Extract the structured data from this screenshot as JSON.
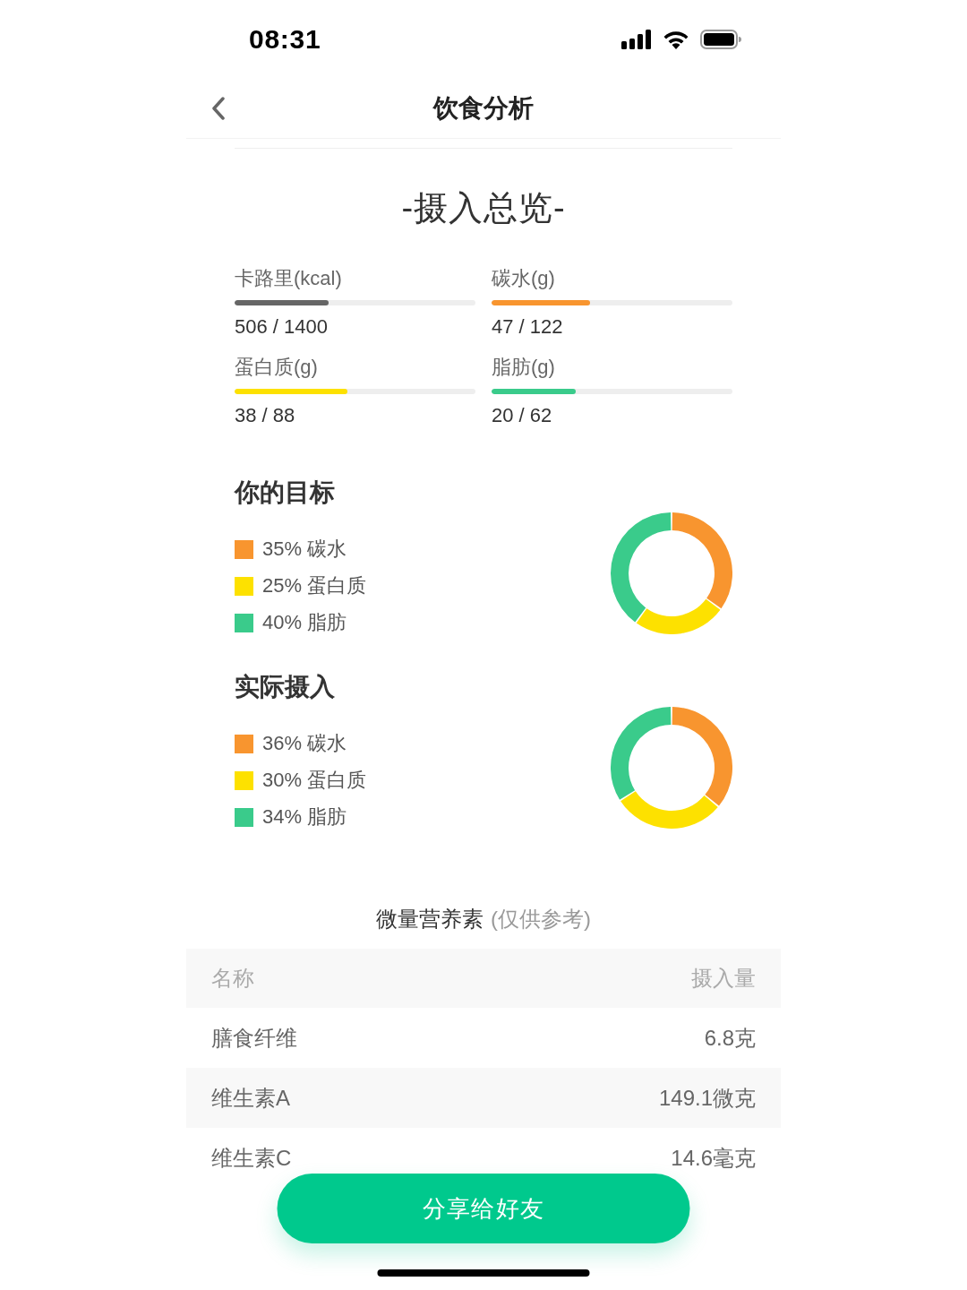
{
  "status_bar": {
    "time": "08:31"
  },
  "nav": {
    "title": "饮食分析"
  },
  "overview": {
    "title": "-摄入总览-",
    "metrics": [
      {
        "label": "卡路里(kcal)",
        "level": 0.39,
        "color": "#666666",
        "reading": "506 / 1400"
      },
      {
        "label": "碳水(g)",
        "level": 0.41,
        "color": "#f8952f",
        "reading": "47 / 122"
      },
      {
        "label": "蛋白质(g)",
        "level": 0.47,
        "color": "#fde100",
        "reading": "38 / 88"
      },
      {
        "label": "脂肪(g)",
        "level": 0.35,
        "color": "#3acb8b",
        "reading": "20 / 62"
      }
    ]
  },
  "goal": {
    "title": "你的目标",
    "legend": [
      {
        "text": "35% 碳水",
        "color": "#f8952f"
      },
      {
        "text": "25% 蛋白质",
        "color": "#fde100"
      },
      {
        "text": "40% 脂肪",
        "color": "#3acb8b"
      }
    ],
    "chart_data": {
      "type": "donut",
      "values": [
        35,
        25,
        40
      ]
    }
  },
  "actual": {
    "title": "实际摄入",
    "legend": [
      {
        "text": "36% 碳水",
        "color": "#f8952f"
      },
      {
        "text": "30% 蛋白质",
        "color": "#fde100"
      },
      {
        "text": "34% 脂肪",
        "color": "#3acb8b"
      }
    ],
    "chart_data": {
      "type": "donut",
      "values": [
        36,
        30,
        34
      ]
    }
  },
  "micronutrients": {
    "title": "微量营养素",
    "note": "(仅供参考)",
    "columns": [
      "名称",
      "摄入量"
    ],
    "rows": [
      [
        "膳食纤维",
        "6.8克"
      ],
      [
        "维生素A",
        "149.1微克"
      ],
      [
        "维生素C",
        "14.6毫克"
      ]
    ]
  },
  "share_button": {
    "label": "分享给好友"
  }
}
